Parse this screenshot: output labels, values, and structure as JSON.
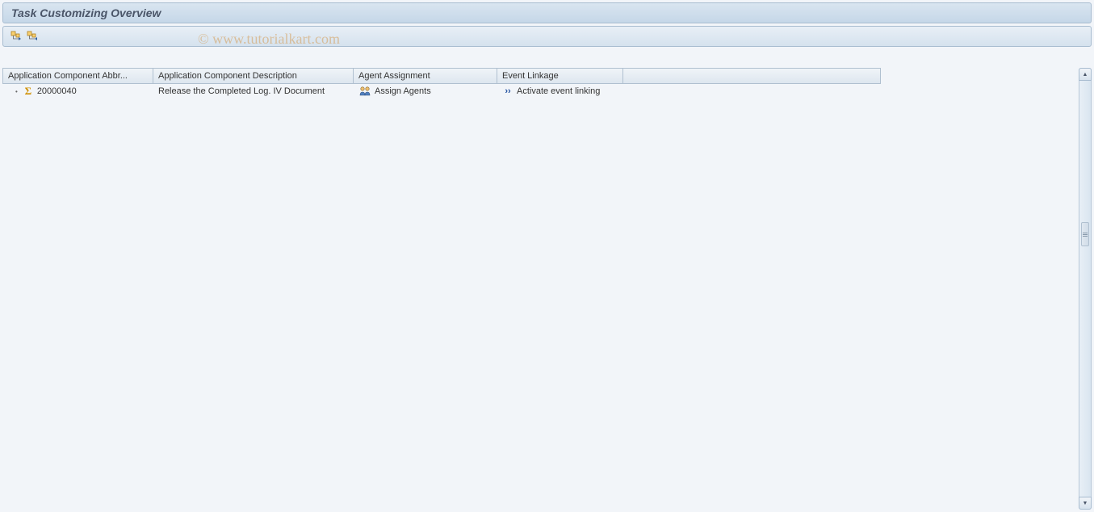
{
  "title": "Task Customizing Overview",
  "watermark": "© www.tutorialkart.com",
  "columns": {
    "abbr": "Application Component Abbr...",
    "desc": "Application Component Description",
    "agent": "Agent Assignment",
    "event": "Event Linkage"
  },
  "rows": [
    {
      "abbr": "20000040",
      "desc": "Release the Completed Log. IV Document",
      "agent": "Assign Agents",
      "event": "Activate event linking"
    }
  ]
}
